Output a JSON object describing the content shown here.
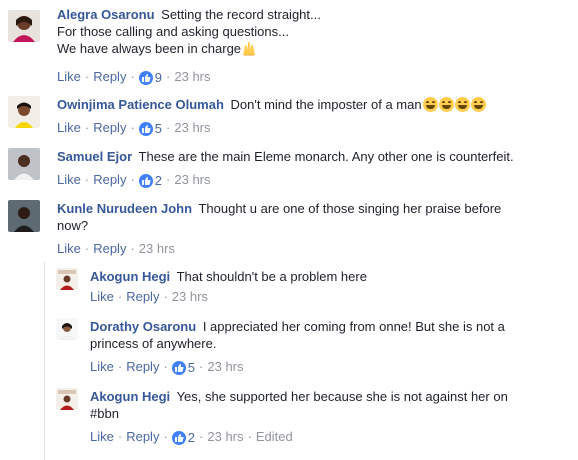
{
  "comments": [
    {
      "name": "Alegra Osaronu",
      "lines": [
        "Setting the record straight...",
        "For those calling and asking questions...",
        "We have always been in charge"
      ],
      "like": "Like",
      "reply": "Reply",
      "reactions": "9",
      "time": "23 hrs",
      "emoji": "raised-hands"
    },
    {
      "name": "Owinjima Patience Olumah",
      "text": "Don't mind the imposter of a man",
      "like": "Like",
      "reply": "Reply",
      "reactions": "5",
      "time": "23 hrs",
      "emoji": "laughing-face x4"
    },
    {
      "name": "Samuel Ejor",
      "text": "These are the main Eleme monarch. Any other one is counterfeit.",
      "like": "Like",
      "reply": "Reply",
      "reactions": "2",
      "time": "23 hrs"
    },
    {
      "name": "Kunle Nurudeen John",
      "text1": "Thought u are one of those singing her praise before",
      "text2": "now?",
      "like": "Like",
      "reply": "Reply",
      "time": "23 hrs"
    }
  ],
  "replies": [
    {
      "name": "Akogun Hegi",
      "text": "That shouldn't be a problem here",
      "like": "Like",
      "reply": "Reply",
      "time": "23 hrs"
    },
    {
      "name": "Dorathy Osaronu",
      "text1": "I appreciated her coming from onne! But she is not a",
      "text2": "princess of anywhere.",
      "like": "Like",
      "reply": "Reply",
      "reactions": "5",
      "time": "23 hrs"
    },
    {
      "name": "Akogun Hegi",
      "text1": "Yes, she supported her because she is not against her on",
      "text2": "#bbn",
      "like": "Like",
      "reply": "Reply",
      "reactions": "2",
      "time": "23 hrs",
      "edited": "Edited"
    }
  ],
  "colors": {
    "name": "#365899",
    "link": "#4b67a1",
    "muted": "#90949c",
    "like_icon": "#4080ff"
  }
}
